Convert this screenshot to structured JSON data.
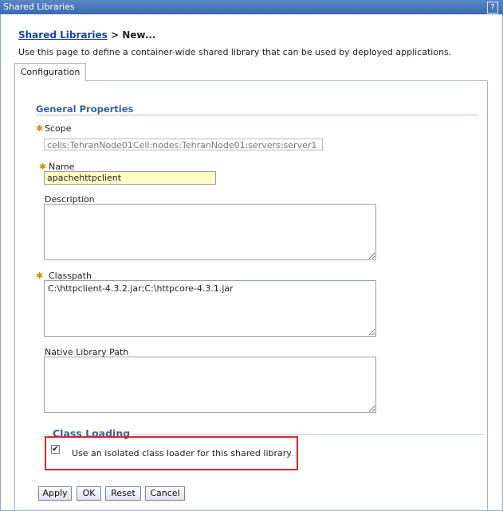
{
  "window": {
    "title": "Shared Libraries",
    "help_label": "?"
  },
  "breadcrumb": {
    "link": "Shared Libraries",
    "separator": " > ",
    "current": "New..."
  },
  "intro_text": "Use this page to define a container-wide shared library that can be used by deployed applications.",
  "tabs": [
    {
      "label": "Configuration",
      "selected": true
    }
  ],
  "general_properties": {
    "heading": "General Properties",
    "scope": {
      "label": "Scope",
      "required": true,
      "value": "cells:TehranNode01Cell:nodes:TehranNode01:servers:server1"
    },
    "name": {
      "label": "Name",
      "required": true,
      "value": "apachehttpclient"
    },
    "description": {
      "label": "Description",
      "value": ""
    },
    "classpath": {
      "label": "Classpath",
      "required": true,
      "value": "C:\\httpclient-4.3.2.jar;C:\\httpcore-4.3.1.jar"
    },
    "native_library_path": {
      "label": "Native Library Path",
      "value": ""
    }
  },
  "class_loading": {
    "heading": "Class Loading",
    "isolated_loader": {
      "label": "Use an isolated class loader for this shared library",
      "checked": true
    }
  },
  "buttons": {
    "apply": "Apply",
    "ok": "OK",
    "reset": "Reset",
    "cancel": "Cancel"
  },
  "colors": {
    "title_bar": "#4a78bb",
    "section_heading": "#3b5f98",
    "link": "#17449a",
    "highlight_box": "#e0242c",
    "required_marker": "#c79400"
  },
  "icons": {
    "required_marker": "asterisk-icon",
    "checkbox_mark": "checkmark-icon"
  }
}
